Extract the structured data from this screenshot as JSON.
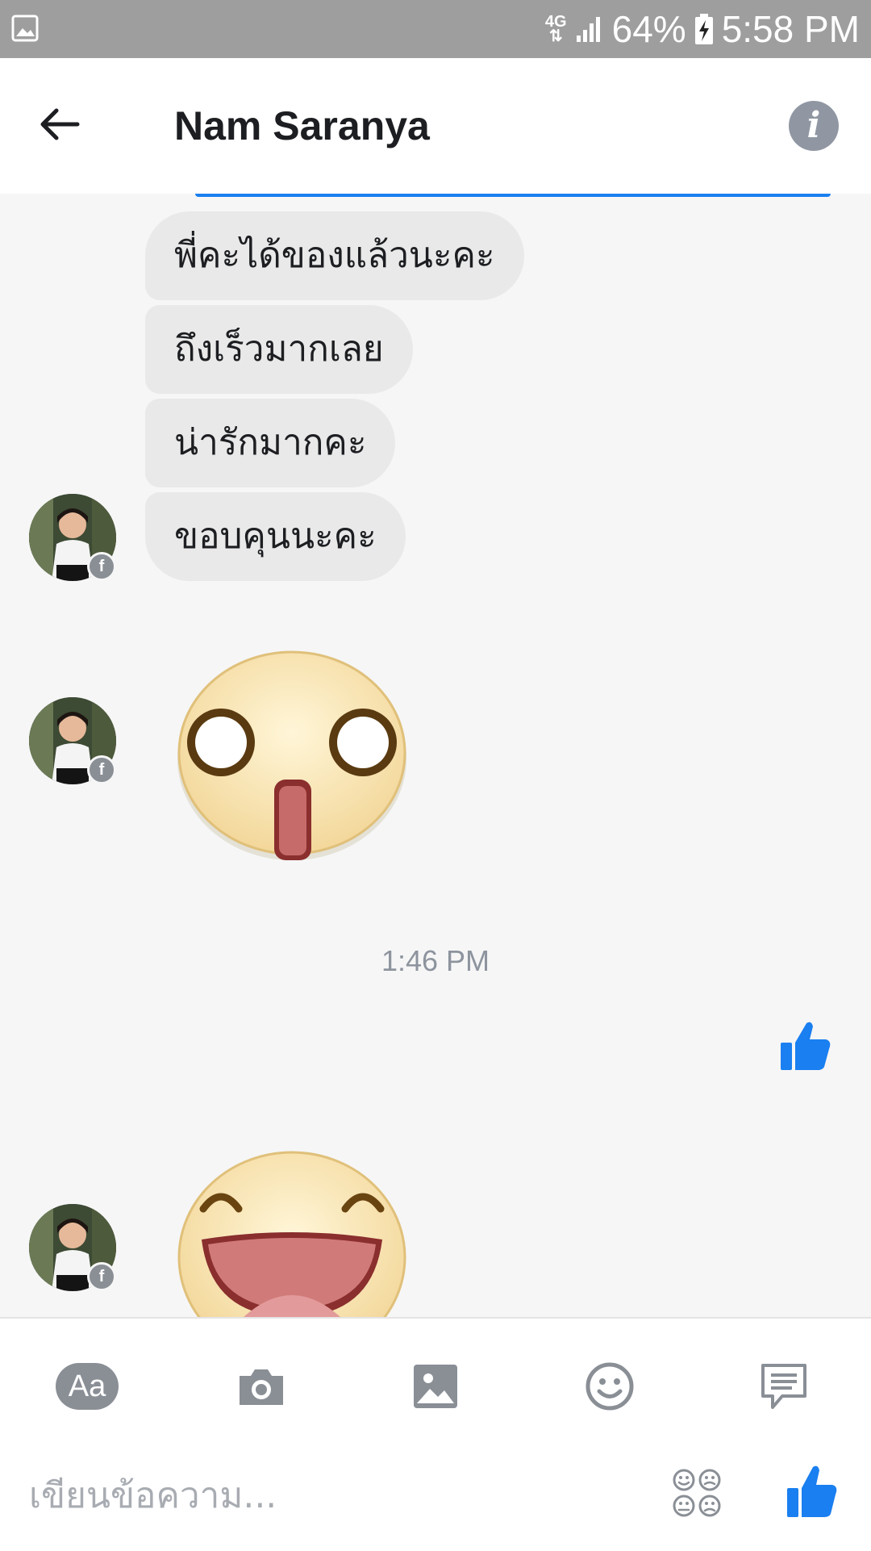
{
  "status_bar": {
    "network": "4G",
    "battery": "64%",
    "time": "5:58 PM"
  },
  "header": {
    "title": "Nam Saranya"
  },
  "messages": [
    {
      "text": "พี่คะได้ของแล้วนะคะ"
    },
    {
      "text": "ถึงเร็วมากเลย"
    },
    {
      "text": "น่ารักมากคะ"
    },
    {
      "text": "ขอบคุนนะคะ"
    }
  ],
  "timestamp": "1:46 PM",
  "composer": {
    "aa_label": "Aa",
    "placeholder": "เขียนข้อความ..."
  },
  "colors": {
    "accent": "#1a7ff0",
    "bubble": "#e9e9e9",
    "status_bar": "#9e9e9e"
  }
}
